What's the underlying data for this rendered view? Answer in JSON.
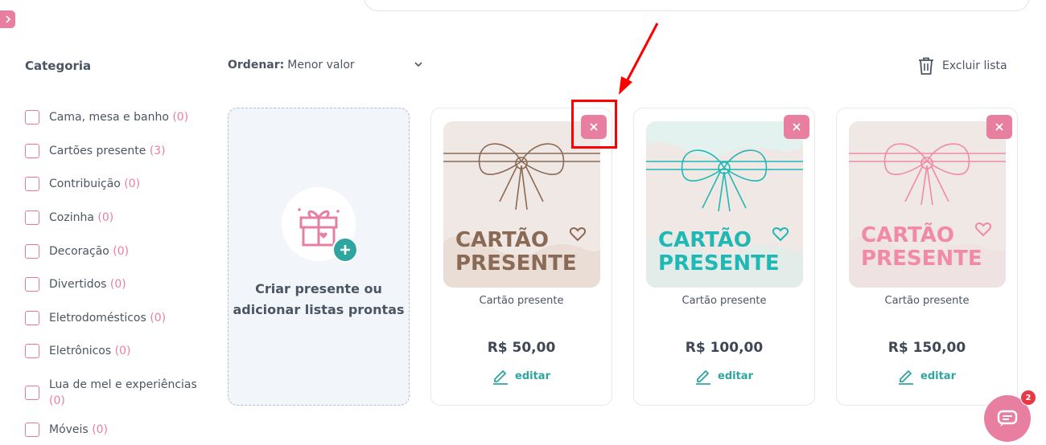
{
  "sidebar": {
    "title": "Categoria",
    "categories": [
      {
        "label": "Cama, mesa e banho",
        "count": "(0)"
      },
      {
        "label": "Cartões presente",
        "count": "(3)"
      },
      {
        "label": "Contribuição",
        "count": "(0)"
      },
      {
        "label": "Cozinha",
        "count": "(0)"
      },
      {
        "label": "Decoração",
        "count": "(0)"
      },
      {
        "label": "Divertidos",
        "count": "(0)"
      },
      {
        "label": "Eletrodomésticos",
        "count": "(0)"
      },
      {
        "label": "Eletrônicos",
        "count": "(0)"
      },
      {
        "label": "Lua de mel e experiências",
        "count": "(0)"
      },
      {
        "label": "Móveis",
        "count": "(0)"
      }
    ]
  },
  "toolbar": {
    "sort_label": "Ordenar:",
    "sort_value": "Menor valor",
    "delete_list_label": "Excluir lista"
  },
  "create_card": {
    "label": "Criar presente ou adicionar listas prontas"
  },
  "products": [
    {
      "name": "Cartão presente",
      "price": "R$ 50,00",
      "edit_label": "editar",
      "image_line1": "CARTÃO",
      "image_line2": "PRESENTE",
      "accent": "#8b6a55"
    },
    {
      "name": "Cartão presente",
      "price": "R$ 100,00",
      "edit_label": "editar",
      "image_line1": "CARTÃO",
      "image_line2": "PRESENTE",
      "accent": "#1fb8b5"
    },
    {
      "name": "Cartão presente",
      "price": "R$ 150,00",
      "edit_label": "editar",
      "image_line1": "CARTÃO",
      "image_line2": "PRESENTE",
      "accent": "#f08aa6"
    }
  ],
  "chat": {
    "badge_count": "2"
  },
  "colors": {
    "brand_pink": "#e87fa0",
    "brand_teal": "#2fa5a0",
    "highlight_red": "#ff0000"
  }
}
